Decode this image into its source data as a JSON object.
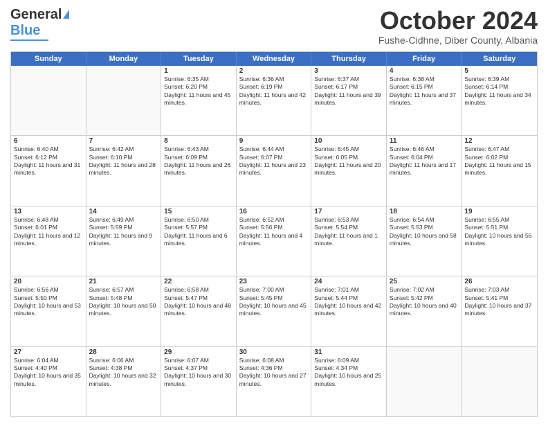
{
  "logo": {
    "line1": "General",
    "line2": "Blue"
  },
  "title": "October 2024",
  "subtitle": "Fushe-Cidhne, Diber County, Albania",
  "header_days": [
    "Sunday",
    "Monday",
    "Tuesday",
    "Wednesday",
    "Thursday",
    "Friday",
    "Saturday"
  ],
  "weeks": [
    [
      {
        "day": "",
        "empty": true
      },
      {
        "day": "",
        "empty": true
      },
      {
        "day": "1",
        "sunrise": "Sunrise: 6:35 AM",
        "sunset": "Sunset: 6:20 PM",
        "daylight": "Daylight: 11 hours and 45 minutes."
      },
      {
        "day": "2",
        "sunrise": "Sunrise: 6:36 AM",
        "sunset": "Sunset: 6:19 PM",
        "daylight": "Daylight: 11 hours and 42 minutes."
      },
      {
        "day": "3",
        "sunrise": "Sunrise: 6:37 AM",
        "sunset": "Sunset: 6:17 PM",
        "daylight": "Daylight: 11 hours and 39 minutes."
      },
      {
        "day": "4",
        "sunrise": "Sunrise: 6:38 AM",
        "sunset": "Sunset: 6:15 PM",
        "daylight": "Daylight: 11 hours and 37 minutes."
      },
      {
        "day": "5",
        "sunrise": "Sunrise: 6:39 AM",
        "sunset": "Sunset: 6:14 PM",
        "daylight": "Daylight: 11 hours and 34 minutes."
      }
    ],
    [
      {
        "day": "6",
        "sunrise": "Sunrise: 6:40 AM",
        "sunset": "Sunset: 6:12 PM",
        "daylight": "Daylight: 11 hours and 31 minutes."
      },
      {
        "day": "7",
        "sunrise": "Sunrise: 6:42 AM",
        "sunset": "Sunset: 6:10 PM",
        "daylight": "Daylight: 11 hours and 28 minutes."
      },
      {
        "day": "8",
        "sunrise": "Sunrise: 6:43 AM",
        "sunset": "Sunset: 6:09 PM",
        "daylight": "Daylight: 11 hours and 26 minutes."
      },
      {
        "day": "9",
        "sunrise": "Sunrise: 6:44 AM",
        "sunset": "Sunset: 6:07 PM",
        "daylight": "Daylight: 11 hours and 23 minutes."
      },
      {
        "day": "10",
        "sunrise": "Sunrise: 6:45 AM",
        "sunset": "Sunset: 6:05 PM",
        "daylight": "Daylight: 11 hours and 20 minutes."
      },
      {
        "day": "11",
        "sunrise": "Sunrise: 6:46 AM",
        "sunset": "Sunset: 6:04 PM",
        "daylight": "Daylight: 11 hours and 17 minutes."
      },
      {
        "day": "12",
        "sunrise": "Sunrise: 6:47 AM",
        "sunset": "Sunset: 6:02 PM",
        "daylight": "Daylight: 11 hours and 15 minutes."
      }
    ],
    [
      {
        "day": "13",
        "sunrise": "Sunrise: 6:48 AM",
        "sunset": "Sunset: 6:01 PM",
        "daylight": "Daylight: 11 hours and 12 minutes."
      },
      {
        "day": "14",
        "sunrise": "Sunrise: 6:49 AM",
        "sunset": "Sunset: 5:59 PM",
        "daylight": "Daylight: 11 hours and 9 minutes."
      },
      {
        "day": "15",
        "sunrise": "Sunrise: 6:50 AM",
        "sunset": "Sunset: 5:57 PM",
        "daylight": "Daylight: 11 hours and 6 minutes."
      },
      {
        "day": "16",
        "sunrise": "Sunrise: 6:52 AM",
        "sunset": "Sunset: 5:56 PM",
        "daylight": "Daylight: 11 hours and 4 minutes."
      },
      {
        "day": "17",
        "sunrise": "Sunrise: 6:53 AM",
        "sunset": "Sunset: 5:54 PM",
        "daylight": "Daylight: 11 hours and 1 minute."
      },
      {
        "day": "18",
        "sunrise": "Sunrise: 6:54 AM",
        "sunset": "Sunset: 5:53 PM",
        "daylight": "Daylight: 10 hours and 58 minutes."
      },
      {
        "day": "19",
        "sunrise": "Sunrise: 6:55 AM",
        "sunset": "Sunset: 5:51 PM",
        "daylight": "Daylight: 10 hours and 56 minutes."
      }
    ],
    [
      {
        "day": "20",
        "sunrise": "Sunrise: 6:56 AM",
        "sunset": "Sunset: 5:50 PM",
        "daylight": "Daylight: 10 hours and 53 minutes."
      },
      {
        "day": "21",
        "sunrise": "Sunrise: 6:57 AM",
        "sunset": "Sunset: 5:48 PM",
        "daylight": "Daylight: 10 hours and 50 minutes."
      },
      {
        "day": "22",
        "sunrise": "Sunrise: 6:58 AM",
        "sunset": "Sunset: 5:47 PM",
        "daylight": "Daylight: 10 hours and 48 minutes."
      },
      {
        "day": "23",
        "sunrise": "Sunrise: 7:00 AM",
        "sunset": "Sunset: 5:45 PM",
        "daylight": "Daylight: 10 hours and 45 minutes."
      },
      {
        "day": "24",
        "sunrise": "Sunrise: 7:01 AM",
        "sunset": "Sunset: 5:44 PM",
        "daylight": "Daylight: 10 hours and 42 minutes."
      },
      {
        "day": "25",
        "sunrise": "Sunrise: 7:02 AM",
        "sunset": "Sunset: 5:42 PM",
        "daylight": "Daylight: 10 hours and 40 minutes."
      },
      {
        "day": "26",
        "sunrise": "Sunrise: 7:03 AM",
        "sunset": "Sunset: 5:41 PM",
        "daylight": "Daylight: 10 hours and 37 minutes."
      }
    ],
    [
      {
        "day": "27",
        "sunrise": "Sunrise: 6:04 AM",
        "sunset": "Sunset: 4:40 PM",
        "daylight": "Daylight: 10 hours and 35 minutes."
      },
      {
        "day": "28",
        "sunrise": "Sunrise: 6:06 AM",
        "sunset": "Sunset: 4:38 PM",
        "daylight": "Daylight: 10 hours and 32 minutes."
      },
      {
        "day": "29",
        "sunrise": "Sunrise: 6:07 AM",
        "sunset": "Sunset: 4:37 PM",
        "daylight": "Daylight: 10 hours and 30 minutes."
      },
      {
        "day": "30",
        "sunrise": "Sunrise: 6:08 AM",
        "sunset": "Sunset: 4:36 PM",
        "daylight": "Daylight: 10 hours and 27 minutes."
      },
      {
        "day": "31",
        "sunrise": "Sunrise: 6:09 AM",
        "sunset": "Sunset: 4:34 PM",
        "daylight": "Daylight: 10 hours and 25 minutes."
      },
      {
        "day": "",
        "empty": true
      },
      {
        "day": "",
        "empty": true
      }
    ]
  ]
}
